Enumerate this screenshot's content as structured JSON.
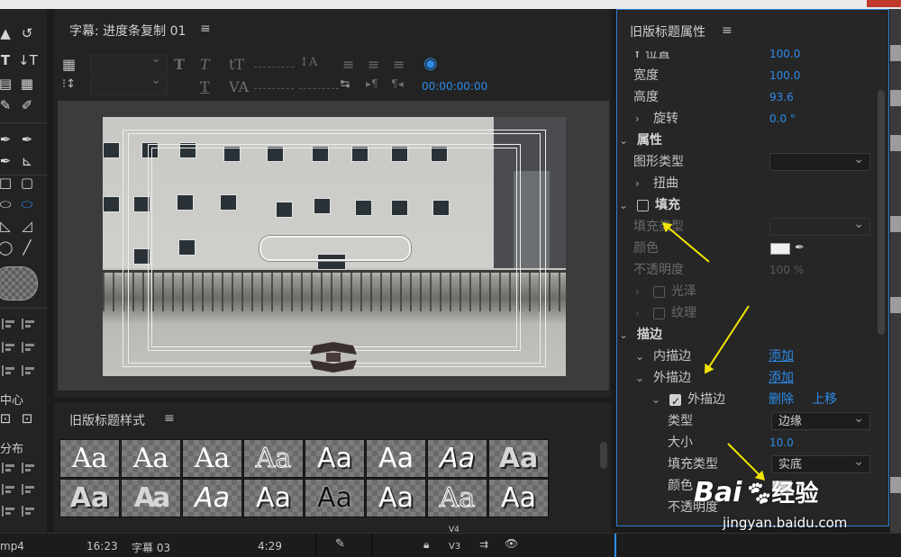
{
  "title_panel": {
    "title": "字幕: 进度条复制 01",
    "timecode": "00:00:00:00"
  },
  "styles_panel": {
    "title": "旧版标题样式",
    "swatch_text": "Aa"
  },
  "tools": {
    "center_label": "中心",
    "distribute_label": "分布"
  },
  "properties": {
    "title": "旧版标题属性",
    "rows": {
      "y_label": "Y 位置",
      "y_value": "100.0",
      "width_label": "宽度",
      "width_value": "100.0",
      "height_label": "高度",
      "height_value": "93.6",
      "rotation_label": "旋转",
      "rotation_value": "0.0 °",
      "attributes_label": "属性",
      "graphic_type_label": "图形类型",
      "distort_label": "扭曲",
      "fill_label": "填充",
      "fill_type_label": "填充类型",
      "color_label": "颜色",
      "opacity_label": "不透明度",
      "opacity_value": "100 %",
      "sheen_label": "光泽",
      "texture_label": "纹理",
      "stroke_label": "描边",
      "inner_stroke_label": "内描边",
      "add_label": "添加",
      "outer_stroke_label": "外描边",
      "outer_stroke_item_label": "外描边",
      "delete_label": "删除",
      "move_up_label": "上移",
      "type_label": "类型",
      "type_value": "边缘",
      "size_label": "大小",
      "size_value": "10.0",
      "stroke_fill_type_label": "填充类型",
      "stroke_fill_type_value": "实底",
      "stroke_color_label": "颜色",
      "stroke_opacity_label": "不透明度"
    }
  },
  "timeline": {
    "clip_ext": "mp4",
    "time_a": "16:23",
    "clip_name": "字幕 03",
    "time_b": "4:29",
    "track_v4": "V4",
    "track_v3": "V3"
  },
  "watermark": {
    "brand": "Bai",
    "brand_cn": "经验",
    "url": "jingyan.baidu.com"
  },
  "colors": {
    "accent": "#2d8ceb",
    "annotation_arrow": "#f2e400"
  }
}
